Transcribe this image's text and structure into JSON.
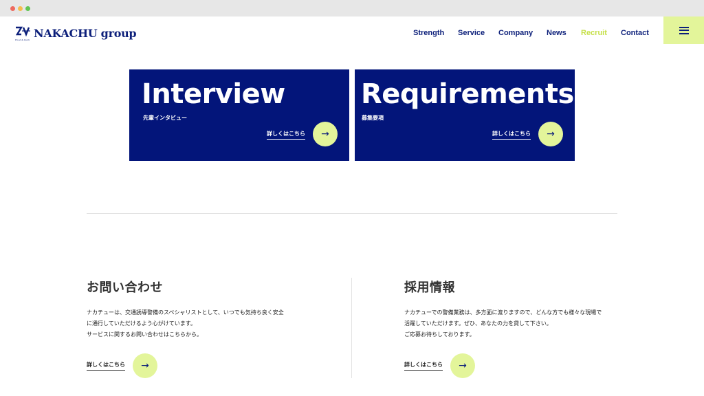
{
  "header": {
    "logo_text": "NAKACHU group",
    "logo_tagline": "Proud & Quick",
    "nav": [
      {
        "label": "Strength"
      },
      {
        "label": "Service"
      },
      {
        "label": "Company"
      },
      {
        "label": "News"
      },
      {
        "label": "Recruit",
        "active": true
      },
      {
        "label": "Contact"
      }
    ],
    "menu_icon": "hamburger-icon"
  },
  "cards": [
    {
      "title": "Interview",
      "subtitle": "先輩インタビュー",
      "link_label": "詳しくはこちら",
      "arrow": "→"
    },
    {
      "title": "Requirements",
      "subtitle": "募集要項",
      "link_label": "詳しくはこちら",
      "arrow": "→"
    }
  ],
  "contact": {
    "title": "お問い合わせ",
    "lines": [
      "ナカチューは、交通誘導警備のスペシャリストとして、いつでも気持ち良く安全",
      "に通行していただけるよう心がけています。",
      "サービスに関するお問い合わせはこちらから。"
    ],
    "link_label": "詳しくはこちら",
    "arrow": "→"
  },
  "recruit": {
    "title": "採用情報",
    "lines": [
      "ナカチューでの警備業務は、多方面に渡りますので、どんな方でも様々な現場で",
      "活躍していただけます。ぜひ、あなたの力を貸して下さい。",
      "ご応募お待ちしております。"
    ],
    "link_label": "詳しくはこちら",
    "arrow": "→"
  },
  "colors": {
    "brand_navy": "#03157a",
    "accent_lime": "#e3f59a",
    "nav_active": "#c6e04a"
  }
}
